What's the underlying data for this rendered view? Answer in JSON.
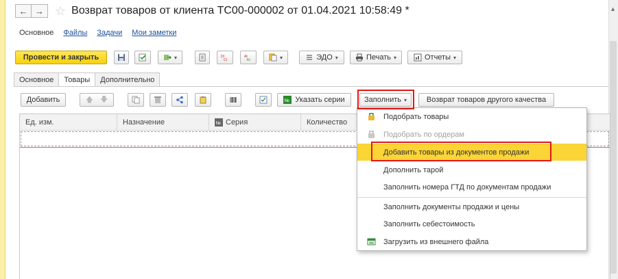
{
  "window": {
    "title": "Возврат товаров от клиента ТС00-000002 от 01.04.2021 10:58:49 *",
    "back_icon": "←",
    "forward_icon": "→",
    "star_icon": "☆"
  },
  "subnav": {
    "items": [
      {
        "label": "Основное",
        "active": true
      },
      {
        "label": "Файлы",
        "active": false
      },
      {
        "label": "Задачи",
        "active": false
      },
      {
        "label": "Мои заметки",
        "active": false
      }
    ]
  },
  "toolbar": {
    "post_close_label": "Провести и закрыть",
    "edo_label": "ЭДО",
    "print_label": "Печать",
    "reports_label": "Отчеты"
  },
  "tabs": [
    {
      "label": "Основное"
    },
    {
      "label": "Товары",
      "active": true
    },
    {
      "label": "Дополнительно"
    }
  ],
  "goods_toolbar": {
    "add_label": "Добавить",
    "series_label": "Указать серии",
    "fill_label": "Заполнить",
    "return_other_quality_label": "Возврат товаров другого качества"
  },
  "grid": {
    "columns": [
      "Ед. изм.",
      "Назначение",
      "Серия",
      "Количество"
    ]
  },
  "fill_menu": {
    "items": [
      {
        "label": "Подобрать товары",
        "icon": "pick-goods-icon",
        "disabled": false
      },
      {
        "label": "Подобрать по ордерам",
        "icon": "pick-orders-icon",
        "disabled": true
      },
      {
        "label": "Добавить товары из документов продажи",
        "highlighted": true
      },
      {
        "label": "Дополнить тарой"
      },
      {
        "label": "Заполнить номера ГТД по документам продажи"
      },
      {
        "label": "Заполнить документы продажи и цены"
      },
      {
        "label": "Заполнить себестоимость"
      },
      {
        "label": "Загрузить из внешнего файла",
        "icon": "load-file-icon"
      }
    ]
  },
  "colors": {
    "accent_yellow": "#fbd436",
    "primary_button": "#f6d10b",
    "annotation_red": "#e01616"
  }
}
